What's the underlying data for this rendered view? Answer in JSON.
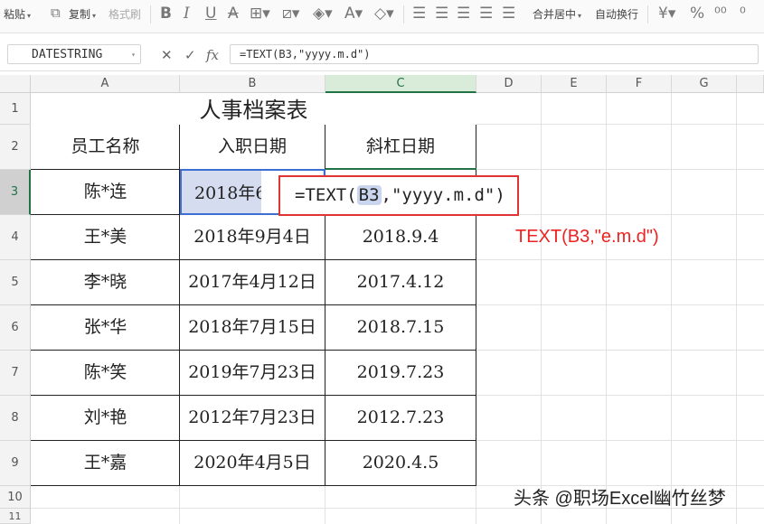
{
  "toolbar": {
    "paste": "粘贴",
    "copy": "复制",
    "format_painter": "格式刷",
    "bold": "B",
    "italic": "I",
    "underline": "U",
    "strike": "A",
    "merge_center": "合并居中",
    "wrap_text": "自动换行",
    "currency": "¥",
    "percent": "%"
  },
  "formula_bar": {
    "name_box": "DATESTRING",
    "fx": "fx",
    "formula": "=TEXT(B3,\"yyyy.m.d\")"
  },
  "columns": [
    "A",
    "B",
    "C",
    "D",
    "E",
    "F",
    "G"
  ],
  "rows": [
    "1",
    "2",
    "3",
    "4",
    "5",
    "6",
    "7",
    "8",
    "9",
    "10",
    "11"
  ],
  "sheet": {
    "title": "人事档案表",
    "headers": [
      "员工名称",
      "入职日期",
      "斜杠日期"
    ],
    "records": [
      {
        "name": "陈*连",
        "date": "2018年6",
        "slash": ""
      },
      {
        "name": "王*美",
        "date": "2018年9月4日",
        "slash": "2018.9.4"
      },
      {
        "name": "李*晓",
        "date": "2017年4月12日",
        "slash": "2017.4.12"
      },
      {
        "name": "张*华",
        "date": "2018年7月15日",
        "slash": "2018.7.15"
      },
      {
        "name": "陈*笑",
        "date": "2019年7月23日",
        "slash": "2019.7.23"
      },
      {
        "name": "刘*艳",
        "date": "2012年7月23日",
        "slash": "2012.7.23"
      },
      {
        "name": "王*嘉",
        "date": "2020年4月5日",
        "slash": "2020.4.5"
      }
    ]
  },
  "editor": {
    "prefix": "=TEXT(",
    "ref": "B3",
    "suffix": ",\"yyyy.m.d\")"
  },
  "annotation": "TEXT(B3,\"e.m.d\")",
  "watermark": "头条 @职场Excel幽竹丝梦",
  "colors": {
    "accent": "#217346",
    "callout": "#e03434",
    "annotation": "#ee2222",
    "selection": "#c9d6ee"
  }
}
